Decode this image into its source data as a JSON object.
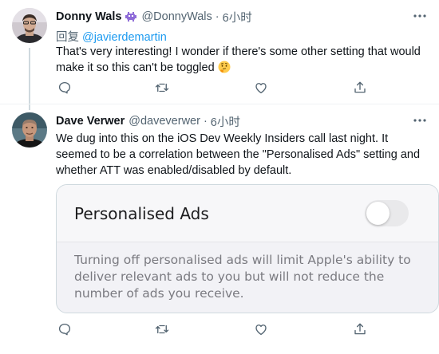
{
  "tweets": [
    {
      "display_name": "Donny Wals",
      "handle": "@DonnyWals",
      "separator": "·",
      "time": "6小时",
      "reply_prefix": "回复",
      "reply_to": "@javierdemartin",
      "text": "That's very interesting! I wonder if there's some other setting that would make it so this can't be toggled",
      "emoji": "thinking-face",
      "more_label": "•••"
    },
    {
      "display_name": "Dave Verwer",
      "handle": "@daveverwer",
      "separator": "·",
      "time": "6小时",
      "text": "We dug into this on the iOS Dev Weekly Insiders call last night. It seemed to be a correlation between the \"Personalised Ads\" setting and whether ATT was enabled/disabled by default.",
      "more_label": "•••",
      "media": {
        "setting_title": "Personalised Ads",
        "toggle_on": false,
        "description": "Turning off personalised ads will limit Apple's ability to deliver relevant ads to you but will not reduce the number of ads you receive."
      }
    }
  ],
  "icons": [
    "reply-icon",
    "retweet-icon",
    "like-icon",
    "share-icon",
    "more-icon",
    "alien-badge-icon"
  ],
  "colors": {
    "link": "#1d9bf0",
    "secondary_text": "#536471",
    "primary_text": "#0f1419",
    "thread_line": "#cfd9de"
  }
}
